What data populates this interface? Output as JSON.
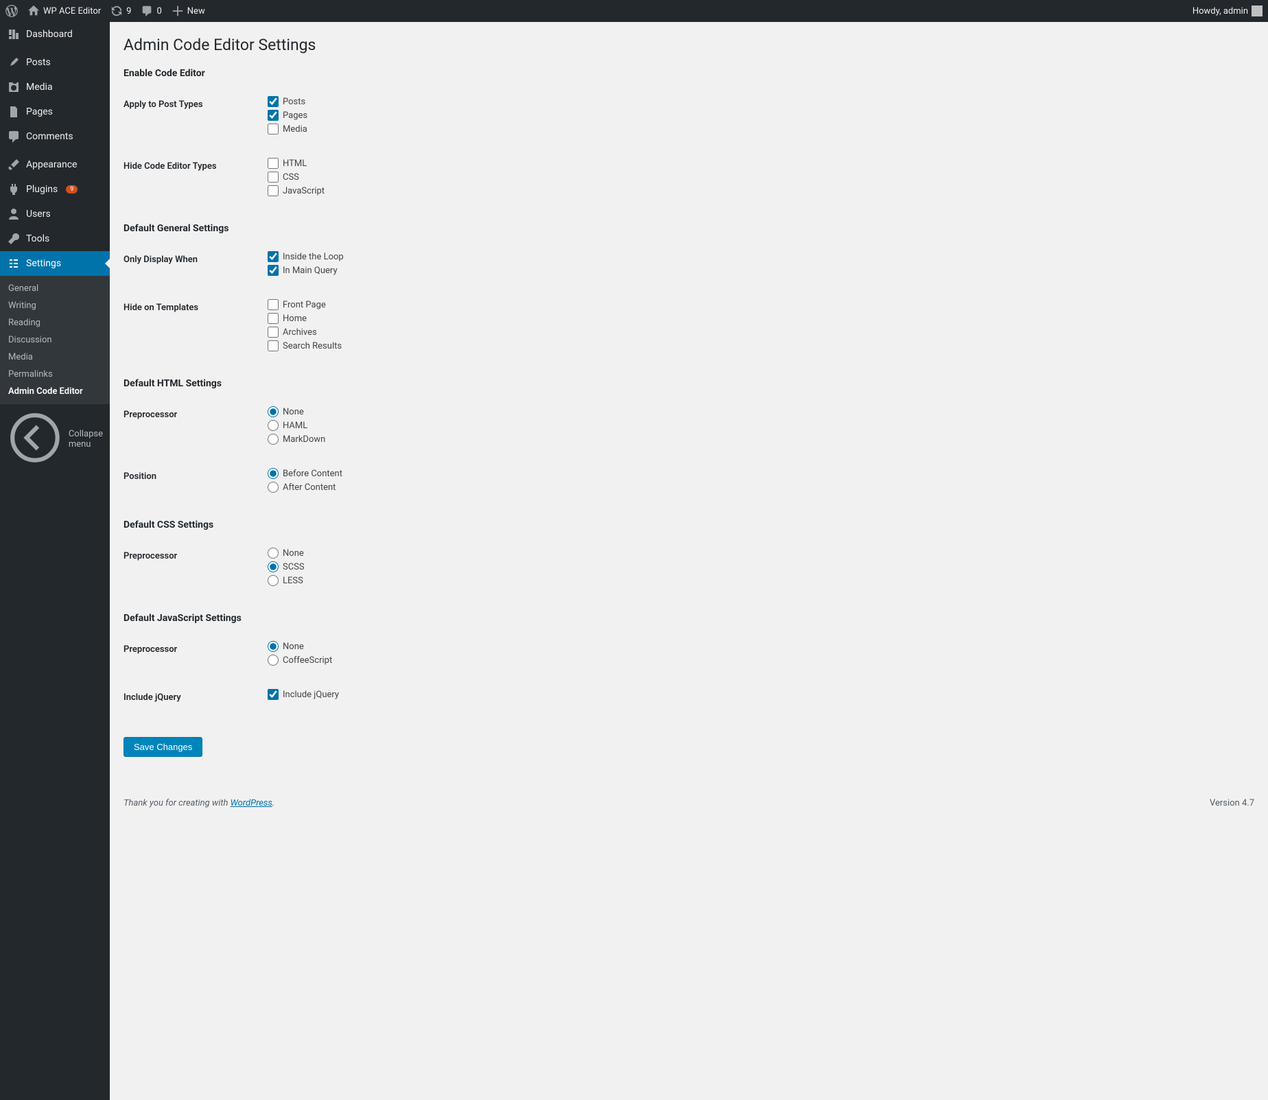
{
  "adminbar": {
    "site_name": "WP ACE Editor",
    "updates_count": "9",
    "comments_count": "0",
    "new_label": "New",
    "howdy": "Howdy, admin"
  },
  "menu": {
    "dashboard": "Dashboard",
    "posts": "Posts",
    "media": "Media",
    "pages": "Pages",
    "comments": "Comments",
    "appearance": "Appearance",
    "plugins": "Plugins",
    "plugins_badge": "9",
    "users": "Users",
    "tools": "Tools",
    "settings": "Settings",
    "collapse": "Collapse menu"
  },
  "submenu": {
    "general": "General",
    "writing": "Writing",
    "reading": "Reading",
    "discussion": "Discussion",
    "media": "Media",
    "permalinks": "Permalinks",
    "ace": "Admin Code Editor"
  },
  "page": {
    "title": "Admin Code Editor Settings",
    "save_button": "Save Changes"
  },
  "sections": {
    "enable": "Enable Code Editor",
    "general": "Default General Settings",
    "html": "Default HTML Settings",
    "css": "Default CSS Settings",
    "js": "Default JavaScript Settings"
  },
  "fields": {
    "apply_post_types": {
      "label": "Apply to Post Types",
      "options": [
        {
          "label": "Posts",
          "checked": true
        },
        {
          "label": "Pages",
          "checked": true
        },
        {
          "label": "Media",
          "checked": false
        }
      ]
    },
    "hide_editor_types": {
      "label": "Hide Code Editor Types",
      "options": [
        {
          "label": "HTML",
          "checked": false
        },
        {
          "label": "CSS",
          "checked": false
        },
        {
          "label": "JavaScript",
          "checked": false
        }
      ]
    },
    "only_display_when": {
      "label": "Only Display When",
      "options": [
        {
          "label": "Inside the Loop",
          "checked": true
        },
        {
          "label": "In Main Query",
          "checked": true
        }
      ]
    },
    "hide_on_templates": {
      "label": "Hide on Templates",
      "options": [
        {
          "label": "Front Page",
          "checked": false
        },
        {
          "label": "Home",
          "checked": false
        },
        {
          "label": "Archives",
          "checked": false
        },
        {
          "label": "Search Results",
          "checked": false
        }
      ]
    },
    "html_preprocessor": {
      "label": "Preprocessor",
      "options": [
        {
          "label": "None",
          "checked": true
        },
        {
          "label": "HAML",
          "checked": false
        },
        {
          "label": "MarkDown",
          "checked": false
        }
      ]
    },
    "html_position": {
      "label": "Position",
      "options": [
        {
          "label": "Before Content",
          "checked": true
        },
        {
          "label": "After Content",
          "checked": false
        }
      ]
    },
    "css_preprocessor": {
      "label": "Preprocessor",
      "options": [
        {
          "label": "None",
          "checked": false
        },
        {
          "label": "SCSS",
          "checked": true
        },
        {
          "label": "LESS",
          "checked": false
        }
      ]
    },
    "js_preprocessor": {
      "label": "Preprocessor",
      "options": [
        {
          "label": "None",
          "checked": true
        },
        {
          "label": "CoffeeScript",
          "checked": false
        }
      ]
    },
    "include_jquery": {
      "label": "Include jQuery",
      "options": [
        {
          "label": "Include jQuery",
          "checked": true
        }
      ]
    }
  },
  "footer": {
    "thanks_prefix": "Thank you for creating with ",
    "thanks_link": "WordPress",
    "thanks_suffix": ".",
    "version": "Version 4.7"
  }
}
